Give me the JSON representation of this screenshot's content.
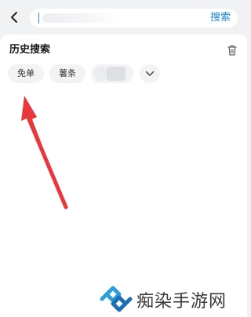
{
  "search": {
    "placeholder": "",
    "button_label": "搜索"
  },
  "history": {
    "title": "历史搜索",
    "chips": [
      {
        "label": "免单"
      },
      {
        "label": "薯条"
      },
      {
        "label": ""
      }
    ]
  },
  "watermark": {
    "text": "痴染手游网"
  },
  "colors": {
    "accent": "#1e88e5",
    "arrow": "#e8383d",
    "chip_bg": "#f2f3f5",
    "page_bg": "#f1f2f4"
  },
  "icons": {
    "back": "chevron-left-icon",
    "trash": "trash-icon",
    "expand": "chevron-down-icon",
    "logo": "watermark-logo-icon"
  }
}
